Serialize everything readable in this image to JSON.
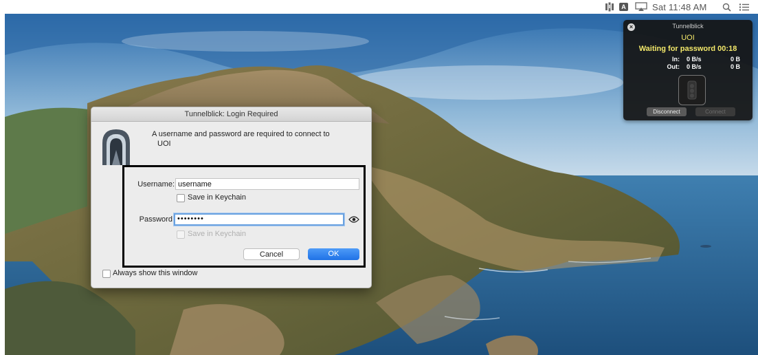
{
  "menubar": {
    "clock": "Sat 11:48 AM",
    "icons": [
      "tunnelblick-menu-icon",
      "keyboard-a-icon",
      "airplay-icon",
      "search-icon",
      "control-center-icon"
    ],
    "keyboard_letter": "A"
  },
  "status_window": {
    "title": "Tunnelblick",
    "config_name": "UOI",
    "state": "Waiting for password 00:18",
    "in_label": "In:",
    "in_rate": "0 B/s",
    "in_total": "0 B",
    "out_label": "Out:",
    "out_rate": "0 B/s",
    "out_total": "0 B",
    "disconnect_label": "Disconnect",
    "connect_label": "Connect"
  },
  "dialog": {
    "title": "Tunnelblick: Login Required",
    "message": "A username and password are required to connect to",
    "config_name": "UOI",
    "icon_badge": "VPN",
    "username_label": "Username:",
    "username_value": "username",
    "save_username_label": "Save in Keychain",
    "password_label": "Password:",
    "password_value": "••••••••",
    "save_password_label": "Save in Keychain",
    "cancel_label": "Cancel",
    "ok_label": "OK",
    "always_show_label": "Always show this window"
  },
  "colors": {
    "accent": "#1f72e6",
    "status_text": "#f3e86a",
    "focus_ring": "#6aa2e0"
  }
}
